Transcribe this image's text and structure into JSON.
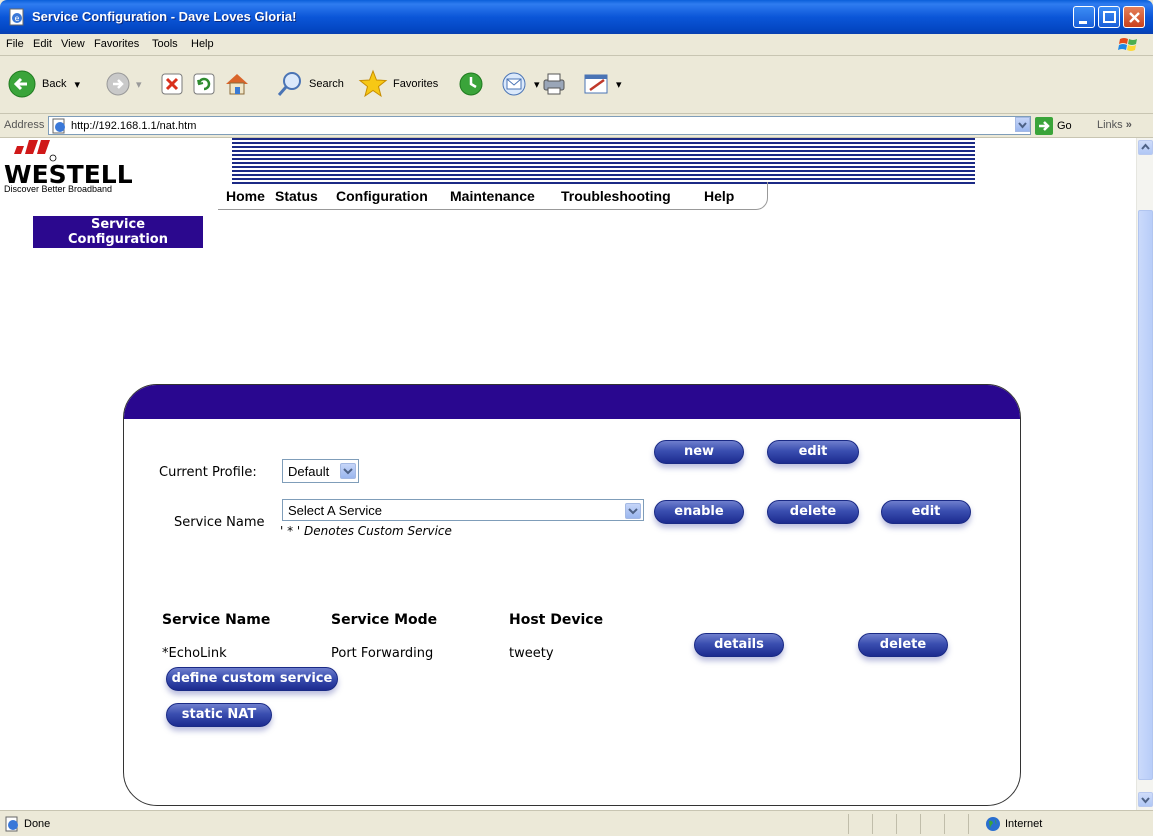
{
  "window": {
    "title": "Service Configuration - Dave Loves Gloria!"
  },
  "menu": [
    "File",
    "Edit",
    "View",
    "Favorites",
    "Tools",
    "Help"
  ],
  "toolbar": {
    "back_label": "Back",
    "search_label": "Search",
    "favorites_label": "Favorites"
  },
  "address": {
    "label": "Address",
    "url": "http://192.168.1.1/nat.htm",
    "go_label": "Go",
    "links_label": "Links"
  },
  "page": {
    "brand": "WESTELL",
    "tagline": "Discover  Better Broadband",
    "nav": [
      "Home",
      "Status",
      "Configuration",
      "Maintenance",
      "Troubleshooting",
      "Help"
    ],
    "section_title_line1": "Service",
    "section_title_line2": "Configuration",
    "profile": {
      "label": "Current Profile:",
      "value": "Default",
      "new_label": "new",
      "edit_label": "edit"
    },
    "service": {
      "label": "Service Name",
      "value": "Select A Service",
      "note": "' * ' Denotes Custom Service",
      "enable_label": "enable",
      "delete_label": "delete",
      "edit_label": "edit"
    },
    "table": {
      "headers": [
        "Service Name",
        "Service Mode",
        "Host Device"
      ],
      "rows": [
        {
          "name": "*EchoLink",
          "mode": "Port Forwarding",
          "host": "tweety",
          "details_label": "details",
          "delete_label": "delete"
        }
      ]
    },
    "define_custom_label": "define custom service",
    "static_nat_label": "static NAT"
  },
  "status": {
    "text": "Done",
    "zone": "Internet"
  },
  "colors": {
    "accent": "#29078f",
    "button": "#3a4eb0",
    "titlebar": "#0b56d8"
  }
}
